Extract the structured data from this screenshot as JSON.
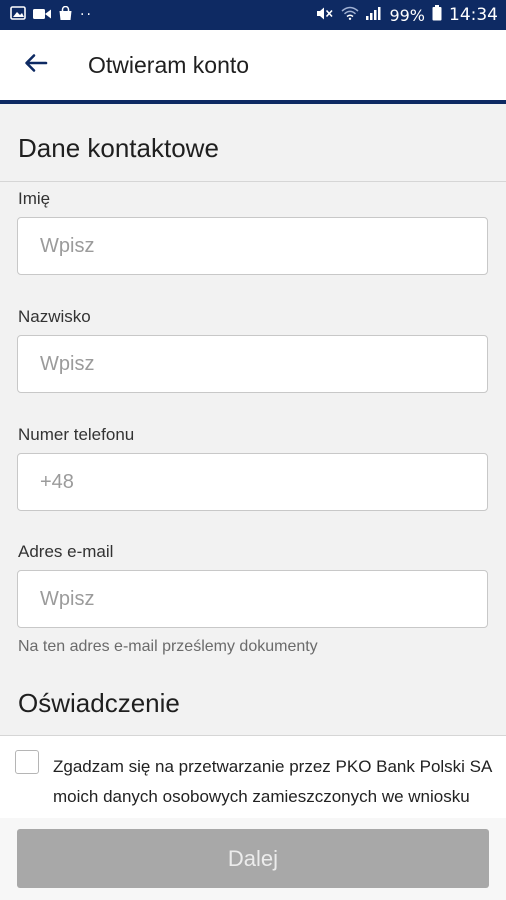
{
  "status_bar": {
    "battery_percent": "99%",
    "time": "14:34",
    "icons": [
      "gallery-icon",
      "video-icon",
      "bag-icon",
      "more-dots-icon",
      "mute-icon",
      "wifi-icon",
      "signal-icon",
      "battery-icon"
    ]
  },
  "app_bar": {
    "back_icon": "arrow-left-icon",
    "title": "Otwieram konto"
  },
  "contact_section": {
    "title": "Dane kontaktowe",
    "fields": [
      {
        "label": "Imię",
        "placeholder": "Wpisz",
        "value": ""
      },
      {
        "label": "Nazwisko",
        "placeholder": "Wpisz",
        "value": ""
      },
      {
        "label": "Numer telefonu",
        "placeholder": "+48",
        "value": ""
      },
      {
        "label": "Adres e-mail",
        "placeholder": "Wpisz",
        "value": ""
      }
    ],
    "email_hint": "Na ten adres e-mail prześlemy dokumenty"
  },
  "statement_section": {
    "title": "Oświadczenie",
    "consent_checked": false,
    "consent_text": "Zgadzam się na przetwarzanie przez PKO Bank Polski SA moich danych osobowych zamieszczonych we wniosku"
  },
  "footer": {
    "next_label": "Dalej"
  },
  "colors": {
    "brand_navy": "#0e2a63",
    "disabled_button": "#a8a8a8",
    "background": "#f2f2f2"
  }
}
